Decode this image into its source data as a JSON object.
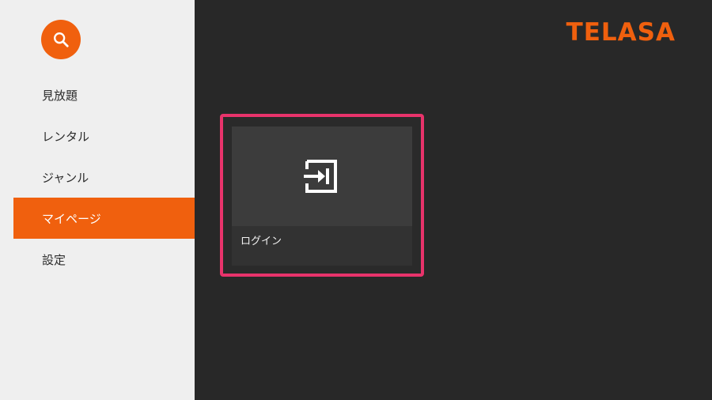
{
  "brand": {
    "logo_text": "TELASA",
    "accent_color": "#f0600e",
    "focus_color": "#e8336b"
  },
  "sidebar": {
    "search_icon": "search-icon",
    "items": [
      {
        "label": "見放題",
        "active": false
      },
      {
        "label": "レンタル",
        "active": false
      },
      {
        "label": "ジャンル",
        "active": false
      },
      {
        "label": "マイページ",
        "active": true
      },
      {
        "label": "設定",
        "active": false
      }
    ]
  },
  "main": {
    "cards": [
      {
        "label": "ログイン",
        "icon": "login-icon",
        "focused": true
      }
    ]
  }
}
